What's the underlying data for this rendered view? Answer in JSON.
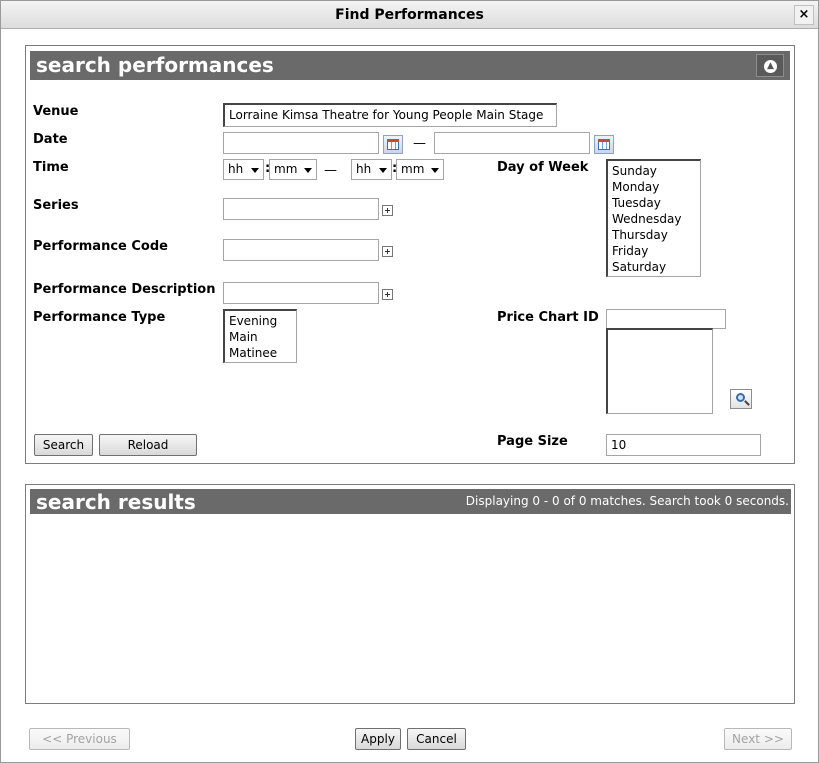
{
  "window": {
    "title": "Find Performances",
    "close_label": "×"
  },
  "search_panel": {
    "title": "search performances",
    "fields": {
      "venue": {
        "label": "Venue",
        "value": "Lorraine Kimsa Theatre for Young People Main Stage"
      },
      "date": {
        "label": "Date",
        "from_value": "",
        "to_value": "",
        "separator": "—"
      },
      "time": {
        "label": "Time",
        "from_hour": "hh",
        "from_minute": "mm",
        "to_hour": "hh",
        "to_minute": "mm",
        "colon": ":",
        "separator": "—"
      },
      "day_of_week": {
        "label": "Day of Week",
        "options": [
          "Sunday",
          "Monday",
          "Tuesday",
          "Wednesday",
          "Thursday",
          "Friday",
          "Saturday"
        ]
      },
      "series": {
        "label": "Series",
        "value": ""
      },
      "performance_code": {
        "label": "Performance Code",
        "value": ""
      },
      "performance_description": {
        "label": "Performance Description",
        "value": ""
      },
      "performance_type": {
        "label": "Performance Type",
        "options": [
          "Evening",
          "Main",
          "Matinee"
        ]
      },
      "price_chart_id": {
        "label": "Price Chart ID",
        "value": ""
      },
      "page_size": {
        "label": "Page Size",
        "value": "10"
      }
    },
    "buttons": {
      "search": "Search",
      "reload": "Reload"
    }
  },
  "results_panel": {
    "title": "search results",
    "status": "Displaying 0 - 0 of 0 matches. Search took 0 seconds."
  },
  "footer": {
    "previous": "<< Previous",
    "apply": "Apply",
    "cancel": "Cancel",
    "next": "Next >>"
  }
}
